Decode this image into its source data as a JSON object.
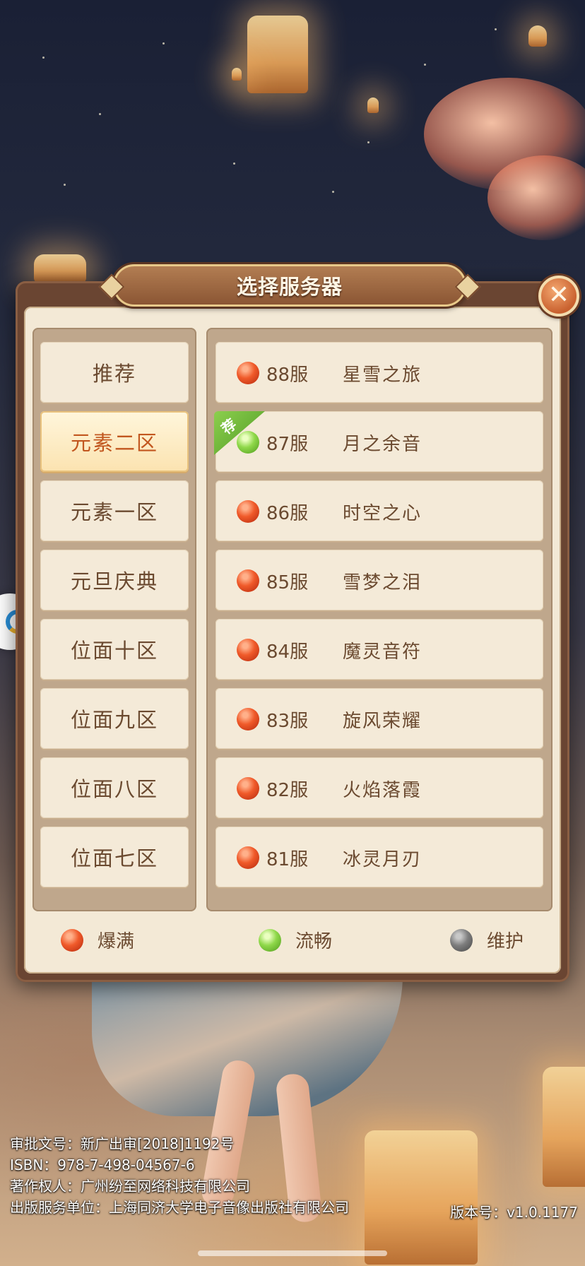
{
  "dialog": {
    "title": "选择服务器",
    "close_label": "✕"
  },
  "zones": [
    {
      "label": "推荐",
      "active": false
    },
    {
      "label": "元素二区",
      "active": true
    },
    {
      "label": "元素一区",
      "active": false
    },
    {
      "label": "元旦庆典",
      "active": false
    },
    {
      "label": "位面十区",
      "active": false
    },
    {
      "label": "位面九区",
      "active": false
    },
    {
      "label": "位面八区",
      "active": false
    },
    {
      "label": "位面七区",
      "active": false
    }
  ],
  "servers": [
    {
      "number": "88服",
      "name": "星雪之旅",
      "status": "red",
      "recommended": false
    },
    {
      "number": "87服",
      "name": "月之余音",
      "status": "green",
      "recommended": true
    },
    {
      "number": "86服",
      "name": "时空之心",
      "status": "red",
      "recommended": false
    },
    {
      "number": "85服",
      "name": "雪梦之泪",
      "status": "red",
      "recommended": false
    },
    {
      "number": "84服",
      "name": "魔灵音符",
      "status": "red",
      "recommended": false
    },
    {
      "number": "83服",
      "name": "旋风荣耀",
      "status": "red",
      "recommended": false
    },
    {
      "number": "82服",
      "name": "火焰落霞",
      "status": "red",
      "recommended": false
    },
    {
      "number": "81服",
      "name": "冰灵月刃",
      "status": "red",
      "recommended": false
    }
  ],
  "recommend_tag": "荐",
  "legend": [
    {
      "label": "爆满",
      "color": "red"
    },
    {
      "label": "流畅",
      "color": "green"
    },
    {
      "label": "维护",
      "color": "gray"
    }
  ],
  "footer": {
    "approval": "审批文号：新广出审[2018]1192号",
    "isbn": "ISBN：978-7-498-04567-6",
    "copyright": "著作权人：广州纷至网络科技有限公司",
    "publisher": "出版服务单位：上海同济大学电子音像出版社有限公司",
    "version": "版本号：v1.0.1177"
  },
  "colors": {
    "accent_active": "#c2571f",
    "text_primary": "#6b4a30",
    "frame": "#6a4532"
  }
}
